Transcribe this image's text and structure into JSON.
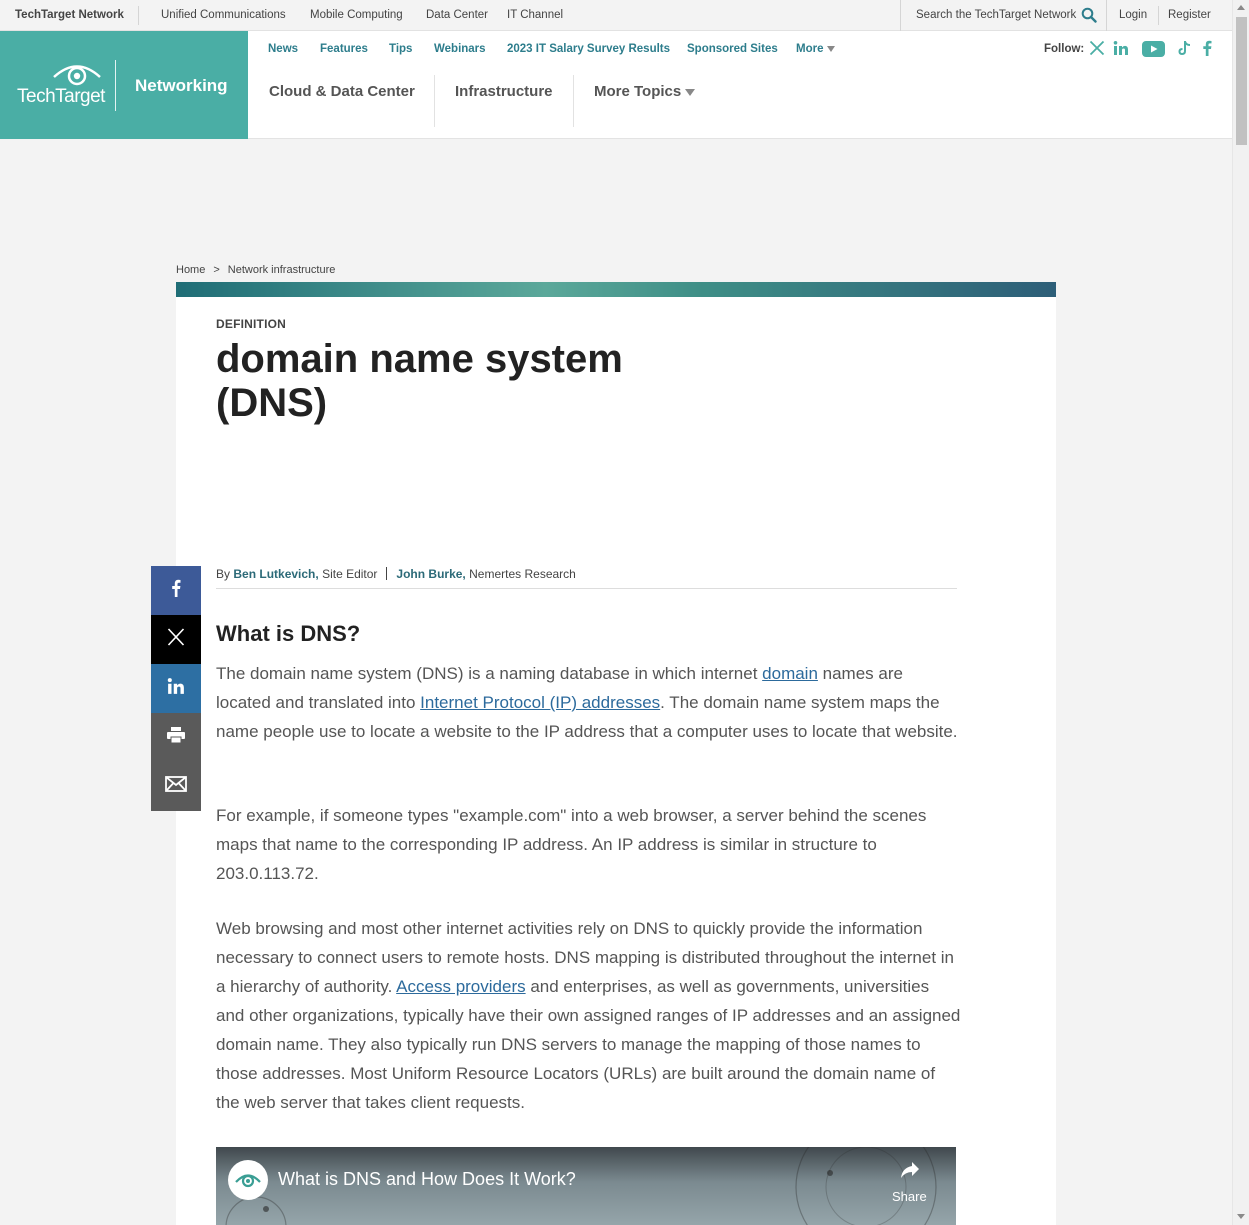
{
  "network_bar": {
    "brand": "TechTarget Network",
    "links": [
      "Unified Communications",
      "Mobile Computing",
      "Data Center",
      "IT Channel"
    ],
    "search_placeholder": "Search the TechTarget Network",
    "login": "Login",
    "register": "Register"
  },
  "header": {
    "logo_text": "TechTarget",
    "section": "Networking",
    "subnav": [
      "News",
      "Features",
      "Tips",
      "Webinars",
      "2023 IT Salary Survey Results",
      "Sponsored Sites",
      "More"
    ],
    "mainnav": [
      "Cloud & Data Center",
      "Infrastructure",
      "More Topics"
    ],
    "follow_label": "Follow:",
    "social_icons": [
      "x-icon",
      "linkedin-icon",
      "youtube-icon",
      "tiktok-icon",
      "facebook-icon"
    ]
  },
  "breadcrumb": {
    "home": "Home",
    "separator": ">",
    "current": "Network infrastructure"
  },
  "article": {
    "kicker": "DEFINITION",
    "title": "domain name system (DNS)",
    "byline": {
      "by": "By",
      "author1": "Ben Lutkevich,",
      "author1_role": "Site Editor",
      "author2": "John Burke,",
      "author2_role": "Nemertes Research"
    },
    "heading": "What is DNS?",
    "p1": {
      "a": "The domain name system (DNS) is a naming database in which internet ",
      "link1": "domain",
      "b": " names are located and translated into ",
      "link2": "Internet Protocol (IP) addresses",
      "c": ". The domain name system maps the name people use to locate a website to the IP address that a computer uses to locate that website."
    },
    "p2": "For example, if someone types \"example.com\" into a web browser, a server behind the scenes maps that name to the corresponding IP address. An IP address is similar in structure to 203.0.113.72.",
    "p3": {
      "a": "Web browsing and most other internet activities rely on DNS to quickly provide the information necessary to connect users to remote hosts. DNS mapping is distributed throughout the internet in a hierarchy of authority. ",
      "link1": "Access providers",
      "b": " and enterprises, as well as governments, universities and other organizations, typically have their own assigned ranges of IP addresses and an assigned domain name. They also typically run DNS servers to manage the mapping of those names to those addresses. Most Uniform Resource Locators (URLs) are built around the domain name of the web server that takes client requests."
    },
    "video": {
      "title": "What is DNS and How Does It Work?",
      "share_label": "Share"
    }
  },
  "share_rail": [
    "facebook-icon",
    "x-icon",
    "linkedin-icon",
    "print-icon",
    "email-icon"
  ],
  "colors": {
    "brand_teal": "#4aaea5",
    "link": "#2c6a9c",
    "subnav": "#2d7d8c"
  }
}
